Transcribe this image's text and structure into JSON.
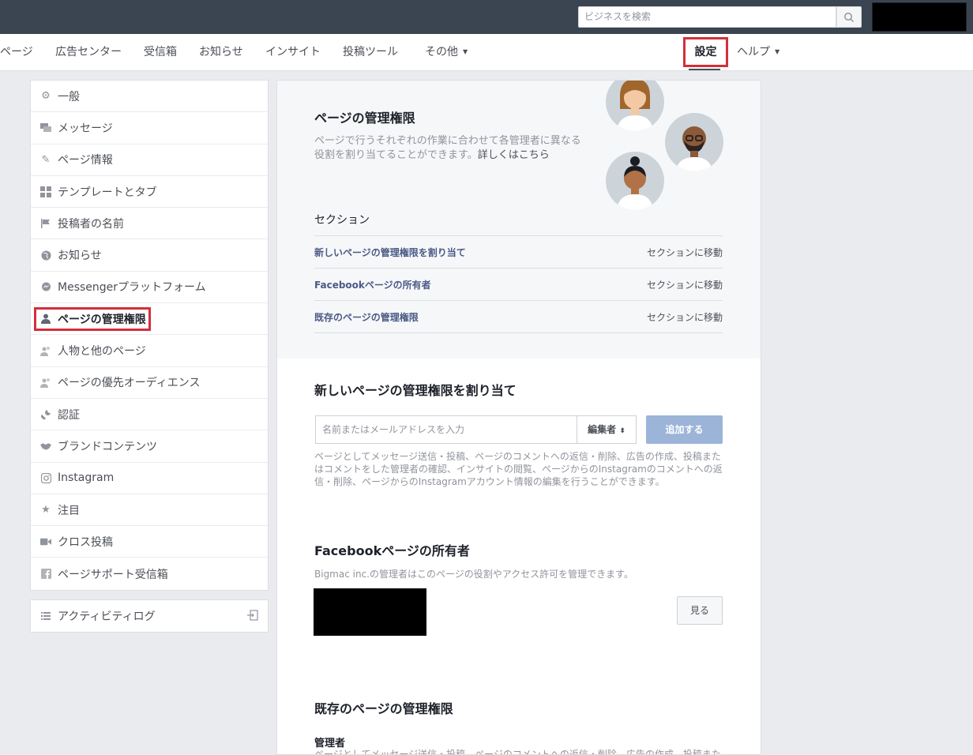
{
  "topbar": {
    "search_placeholder": "ビジネスを検索"
  },
  "nav": {
    "items": [
      "ページ",
      "広告センター",
      "受信箱",
      "お知らせ",
      "インサイト",
      "投稿ツール",
      "その他"
    ],
    "settings": "設定",
    "help": "ヘルプ"
  },
  "sidebar": {
    "items": [
      {
        "label": "一般",
        "icon": "gear-icon"
      },
      {
        "label": "メッセージ",
        "icon": "chat-icon"
      },
      {
        "label": "ページ情報",
        "icon": "pencil-icon"
      },
      {
        "label": "テンプレートとタブ",
        "icon": "grid-icon"
      },
      {
        "label": "投稿者の名前",
        "icon": "flag-icon"
      },
      {
        "label": "お知らせ",
        "icon": "globe-icon"
      },
      {
        "label": "Messengerプラットフォーム",
        "icon": "messenger-icon"
      },
      {
        "label": "ページの管理権限",
        "icon": "person-icon"
      },
      {
        "label": "人物と他のページ",
        "icon": "people-icon"
      },
      {
        "label": "ページの優先オーディエンス",
        "icon": "people-icon"
      },
      {
        "label": "認証",
        "icon": "wrench-icon"
      },
      {
        "label": "ブランドコンテンツ",
        "icon": "handshake-icon"
      },
      {
        "label": "Instagram",
        "icon": "instagram-icon"
      },
      {
        "label": "注目",
        "icon": "star-icon"
      },
      {
        "label": "クロス投稿",
        "icon": "video-icon"
      },
      {
        "label": "ページサポート受信箱",
        "icon": "facebook-icon"
      }
    ],
    "activity_log": "アクティビティログ"
  },
  "main": {
    "roles_title": "ページの管理権限",
    "roles_desc": "ページで行うそれぞれの作業に合わせて各管理者に異なる役割を割り当てることができます。",
    "learn_more": "詳しくはこちら",
    "sections_label": "セクション",
    "sections": [
      {
        "title": "新しいページの管理権限を割り当て",
        "go": "セクションに移動"
      },
      {
        "title": "Facebookページの所有者",
        "go": "セクションに移動"
      },
      {
        "title": "既存のページの管理権限",
        "go": "セクションに移動"
      }
    ],
    "assign_title": "新しいページの管理権限を割り当て",
    "name_placeholder": "名前またはメールアドレスを入力",
    "role_value": "編集者",
    "add_button": "追加する",
    "assign_desc": "ページとしてメッセージ送信・投稿、ページのコメントへの返信・削除、広告の作成、投稿またはコメントをした管理者の確認、インサイトの閲覧、ページからのInstagramのコメントへの返信・削除、ページからのInstagramアカウント情報の編集を行うことができます。",
    "owner_title": "Facebookページの所有者",
    "owner_desc": "Bigmac inc.の管理者はこのページの役割やアクセス許可を管理できます。",
    "view_button": "見る",
    "existing_title": "既存のページの管理権限",
    "admin_label": "管理者",
    "admin_desc": "ページとしてメッセージ送信・投稿、ページのコメントへの返信・削除、広告の作成、投稿また"
  }
}
